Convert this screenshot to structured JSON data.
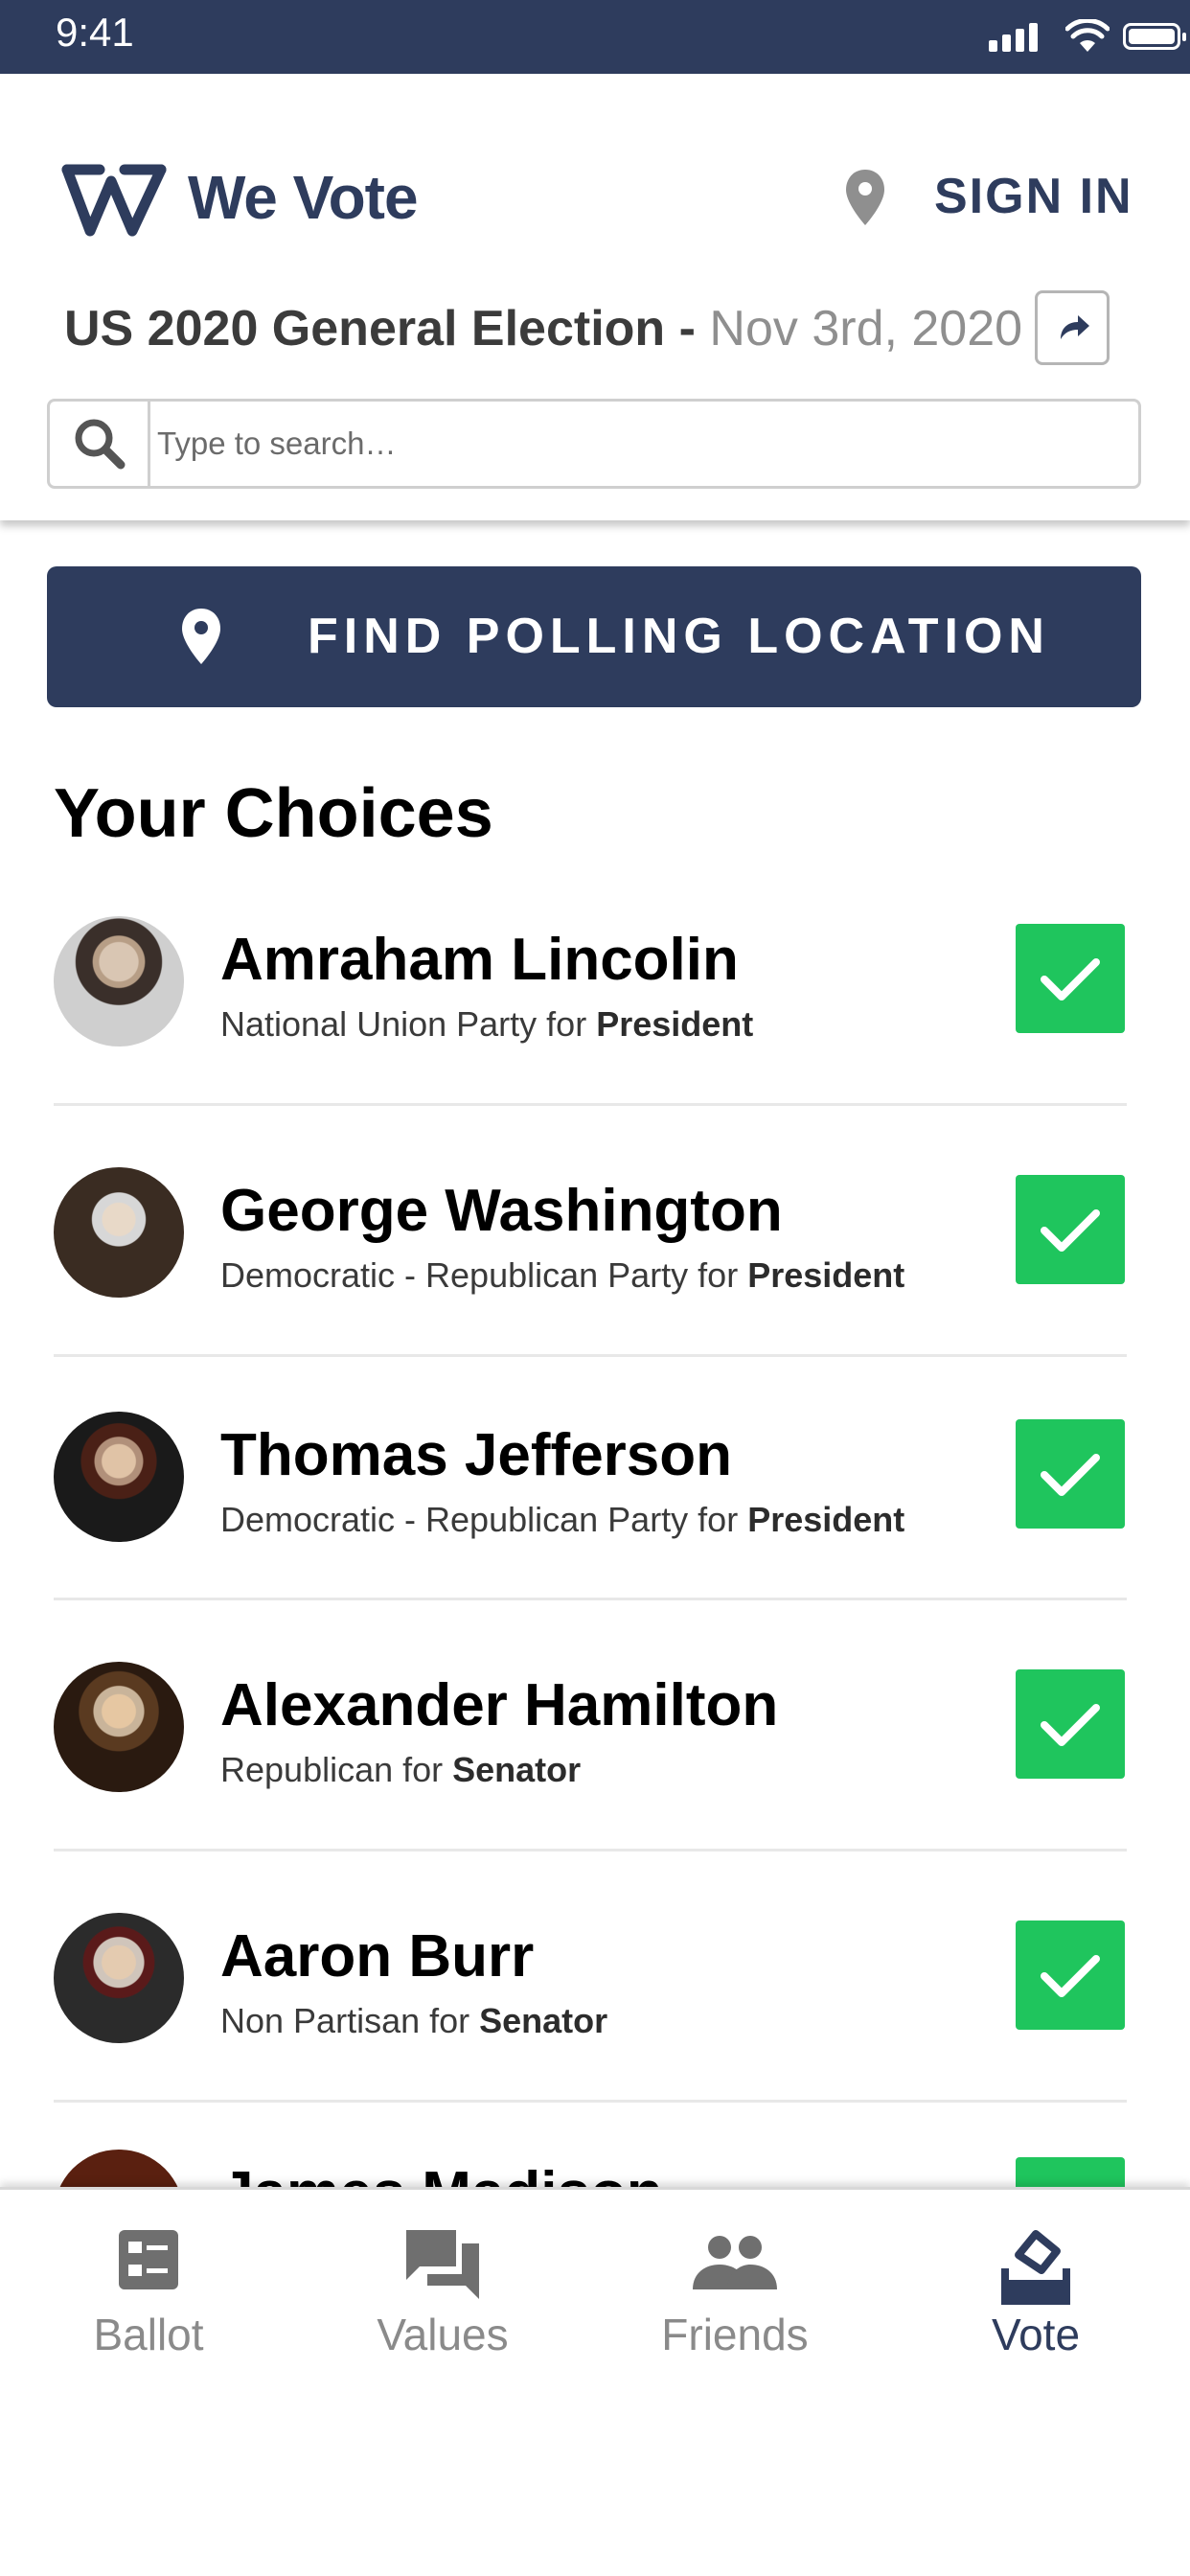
{
  "status_bar": {
    "time": "9:41"
  },
  "header": {
    "brand": "We Vote",
    "sign_in": "SIGN IN",
    "election_name": "US 2020 General Election",
    "election_separator": " - ",
    "election_date": "Nov 3rd, 2020"
  },
  "search": {
    "placeholder": "Type to search…"
  },
  "find_polling": {
    "label": "FIND POLLING LOCATION"
  },
  "choices": {
    "title": "Your Choices",
    "items": [
      {
        "name": "Amraham Lincolin",
        "party": "National Union Party for ",
        "office": "President"
      },
      {
        "name": "George Washington",
        "party": "Democratic - Republican Party for ",
        "office": "President"
      },
      {
        "name": "Thomas Jefferson",
        "party": "Democratic - Republican Party for ",
        "office": "President"
      },
      {
        "name": "Alexander Hamilton",
        "party": "Republican for ",
        "office": "Senator"
      },
      {
        "name": "Aaron Burr",
        "party": "Non Partisan for ",
        "office": "Senator"
      },
      {
        "name": "James Madison",
        "party": "",
        "office": ""
      }
    ]
  },
  "tabs": [
    {
      "label": "Ballot",
      "icon": "ballot-icon",
      "active": false
    },
    {
      "label": "Values",
      "icon": "chat-bubbles-icon",
      "active": false
    },
    {
      "label": "Friends",
      "icon": "people-icon",
      "active": false
    },
    {
      "label": "Vote",
      "icon": "ballot-box-icon",
      "active": true
    }
  ],
  "colors": {
    "brand": "#2e3c5d",
    "check": "#1fc55d",
    "muted": "#8a8a8a"
  }
}
